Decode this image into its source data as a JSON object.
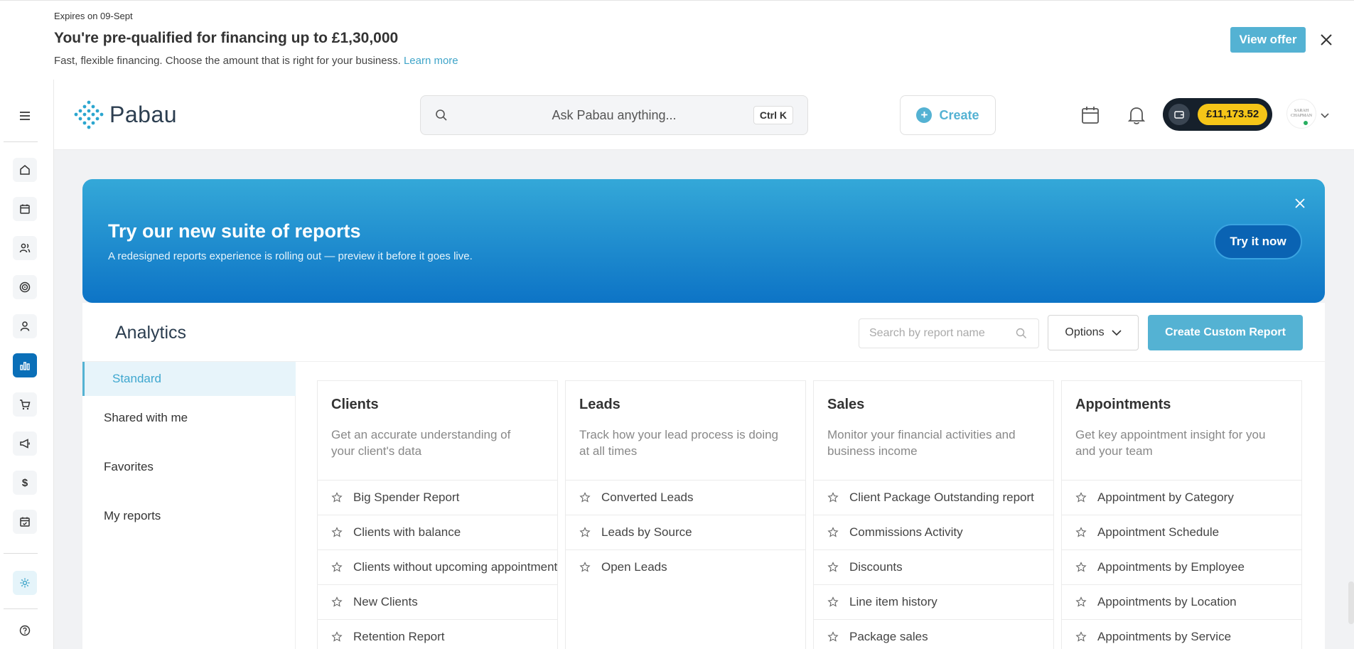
{
  "financing": {
    "expires": "Expires on 09-Sept",
    "title": "You're pre-qualified for financing up to £1,30,000",
    "subtitle": "Fast, flexible financing. Choose the amount that is right for your business.",
    "learn_more": "Learn more",
    "view_offer": "View offer"
  },
  "header": {
    "logo_text": "Pabau",
    "search_placeholder": "Ask Pabau anything...",
    "search_shortcut": "Ctrl K",
    "create_label": "Create",
    "wallet_amount": "£11,173.52",
    "avatar_text": "SARAH CHAPMAN"
  },
  "promo": {
    "title": "Try our new suite of reports",
    "subtitle": "A redesigned reports experience is rolling out — preview it before it goes live.",
    "button": "Try it now"
  },
  "analytics": {
    "title": "Analytics",
    "search_placeholder": "Search by report name",
    "options_label": "Options",
    "create_custom": "Create Custom Report",
    "nav": [
      {
        "label": "Standard",
        "active": true
      },
      {
        "label": "Shared with me",
        "active": false
      },
      {
        "label": "Favorites",
        "active": false
      },
      {
        "label": "My reports",
        "active": false
      }
    ],
    "cards": [
      {
        "title": "Clients",
        "description": "Get an accurate understanding of your client's data",
        "items": [
          "Big Spender Report",
          "Clients with balance",
          "Clients without upcoming appointments",
          "New Clients",
          "Retention Report"
        ]
      },
      {
        "title": "Leads",
        "description": "Track how your lead process is doing at all times",
        "items": [
          "Converted Leads",
          "Leads by Source",
          "Open Leads"
        ]
      },
      {
        "title": "Sales",
        "description": "Monitor your financial activities and business income",
        "items": [
          "Client Package Outstanding report",
          "Commissions Activity",
          "Discounts",
          "Line item history",
          "Package sales"
        ]
      },
      {
        "title": "Appointments",
        "description": "Get key appointment insight for you and your team",
        "items": [
          "Appointment by Category",
          "Appointment Schedule",
          "Appointments by Employee",
          "Appointments by Location",
          "Appointments by Service"
        ]
      }
    ]
  },
  "colors": {
    "accent": "#54b2d3",
    "rail_active": "#0a6fb8",
    "wallet_bg": "#16202b",
    "wallet_amount_bg": "#f5c518"
  },
  "icons": {
    "rail": [
      "menu-icon",
      "home-icon",
      "calendar-icon",
      "clients-icon",
      "target-icon",
      "user-icon",
      "analytics-icon",
      "cart-icon",
      "megaphone-icon",
      "dollar-icon",
      "schedule-icon",
      "settings-icon",
      "help-icon"
    ]
  }
}
